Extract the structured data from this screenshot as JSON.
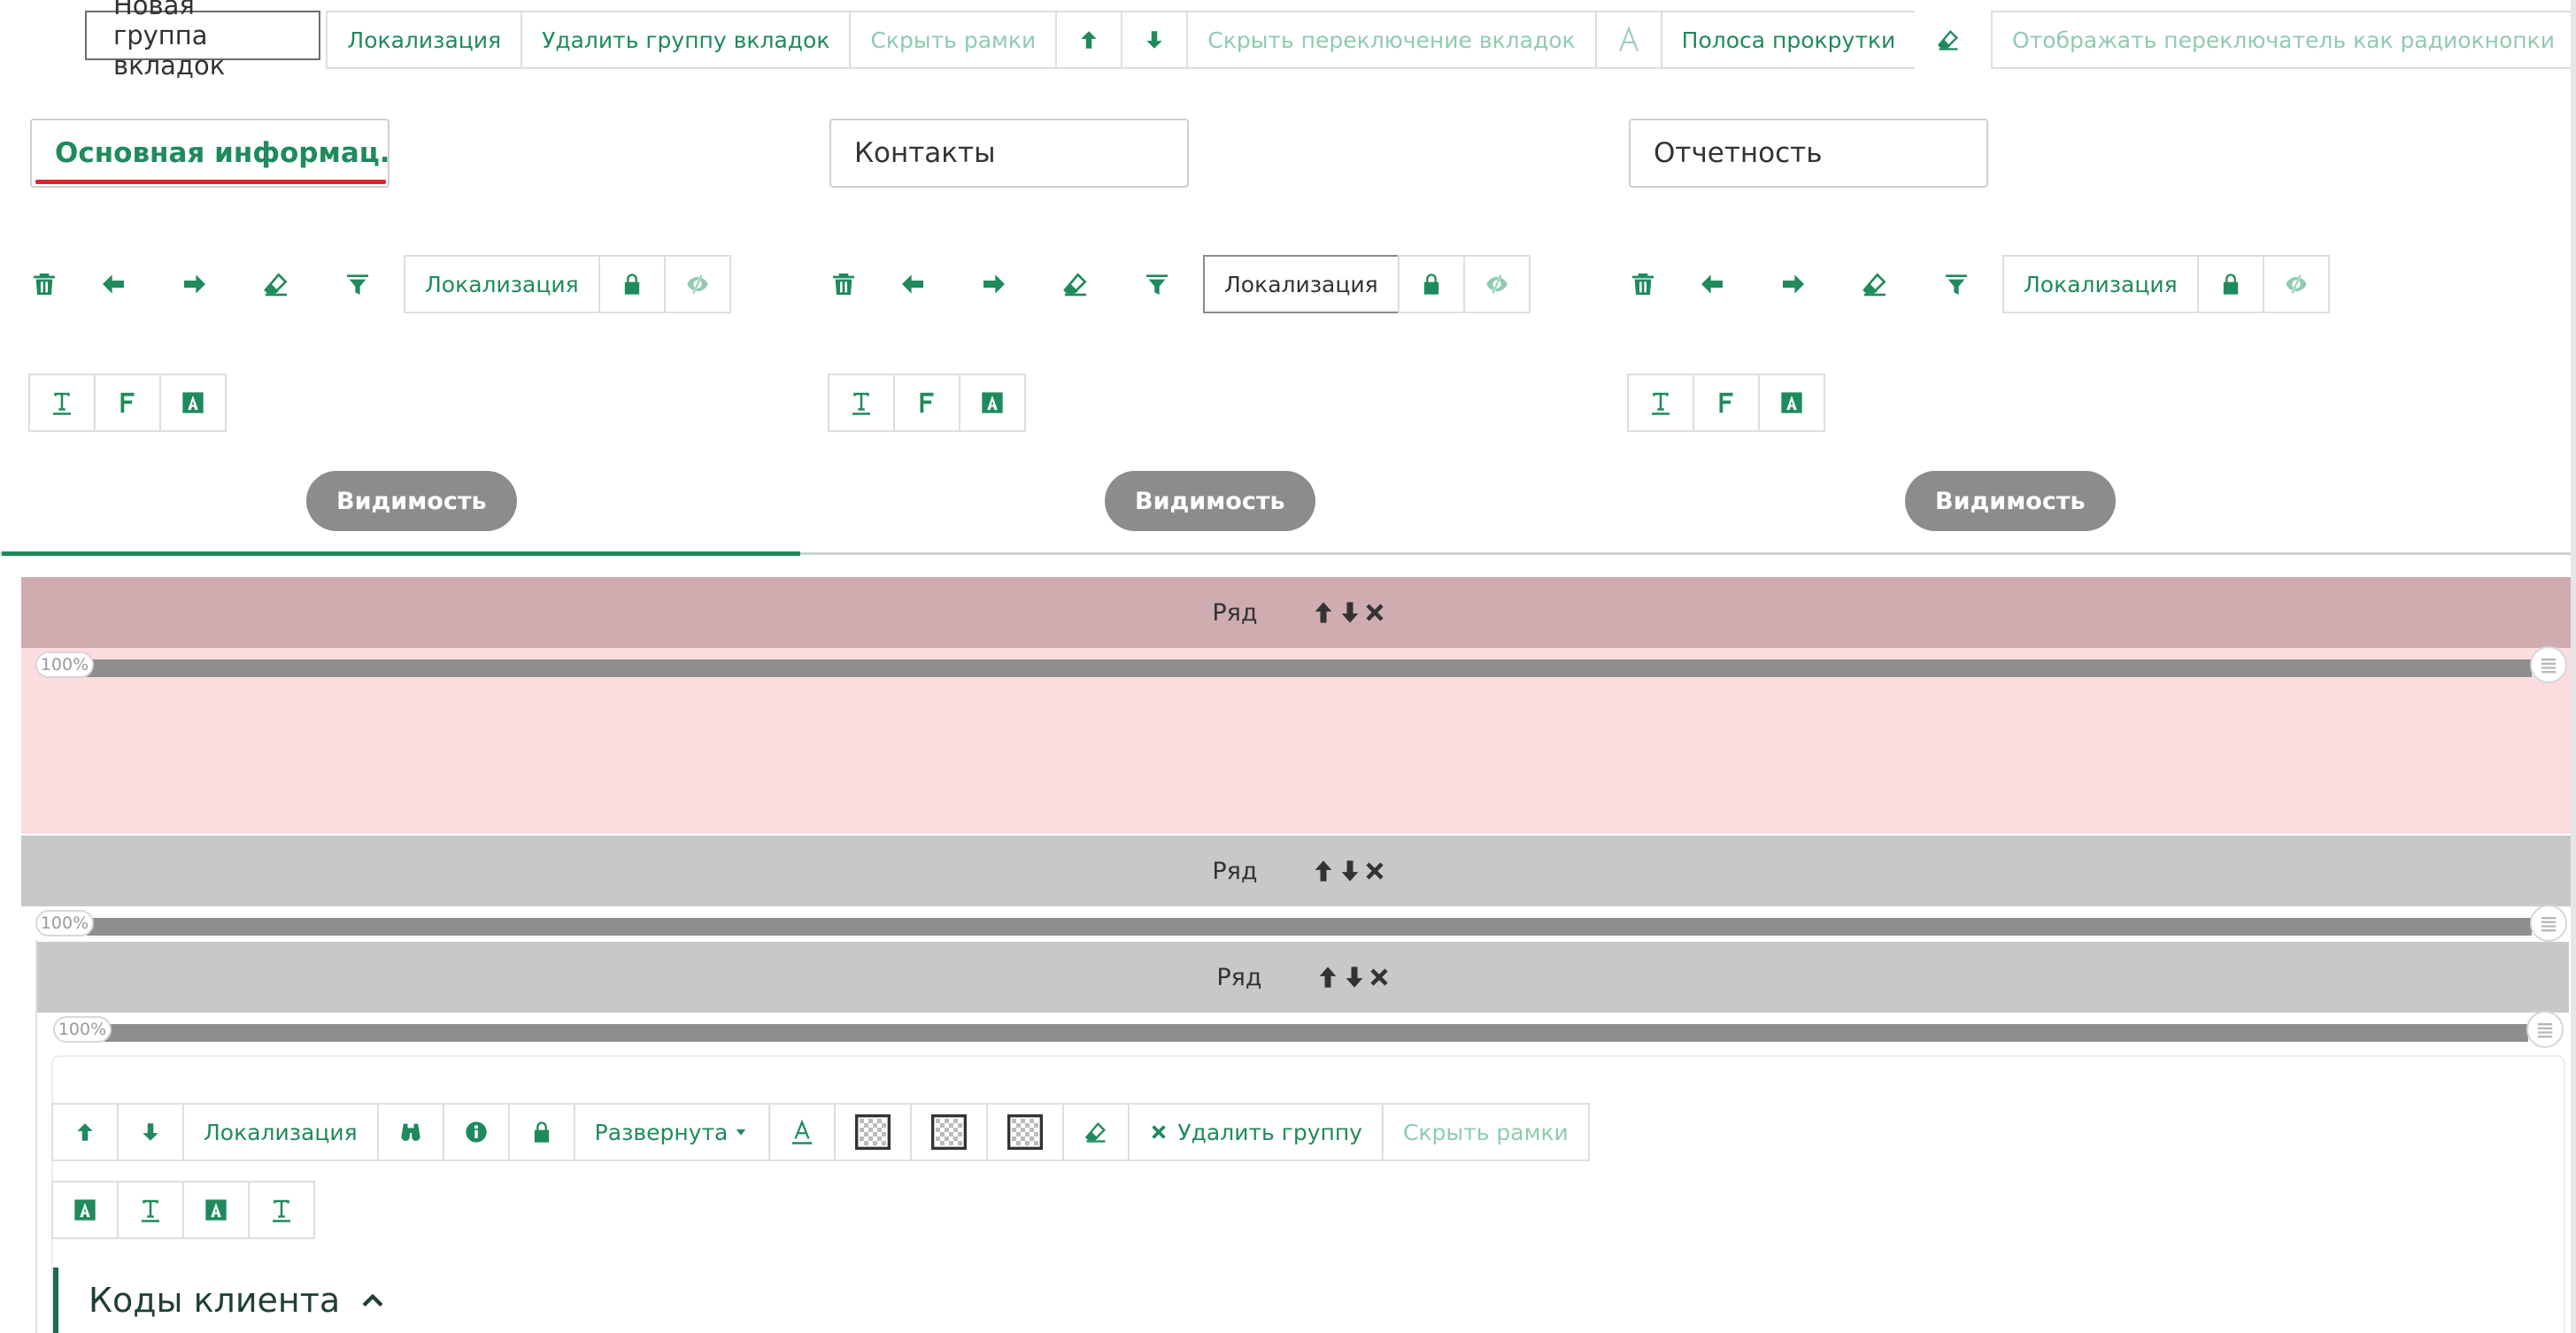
{
  "toolbar": {
    "new_group": "Новая группа вкладок",
    "localization": "Локализация",
    "delete_group": "Удалить группу вкладок",
    "hide_frames": "Скрыть рамки",
    "hide_switch": "Скрыть переключение вкладок",
    "scrollbar": "Полоса прокрутки",
    "radio_switch": "Отображать переключатель как радиокнопки"
  },
  "tabs": [
    {
      "title": "Основная информац...",
      "localization": "Локализация",
      "visibility": "Видимость"
    },
    {
      "title": "Контакты",
      "localization": "Локализация",
      "visibility": "Видимость"
    },
    {
      "title": "Отчетность",
      "localization": "Локализация",
      "visibility": "Видимость"
    }
  ],
  "rows": [
    {
      "label": "Ряд",
      "percent": "100%",
      "width_fraction": 1.0
    },
    {
      "label": "Ряд",
      "percent": "100%",
      "width_fraction": 1.0
    },
    {
      "label": "Ряд",
      "percent": "100%",
      "width_fraction": 1.0
    }
  ],
  "group_toolbar": {
    "localization": "Локализация",
    "state": "Развернута",
    "delete_group": "Удалить группу",
    "hide_frames": "Скрыть рамки"
  },
  "section": {
    "title": "Коды клиента"
  },
  "colors": {
    "accent": "#1f8a5b",
    "accent_light": "#8fcbb0",
    "active_tab_marker": "#d9232d",
    "row1_bar": "#cfacb0",
    "row1_body": "#fcdcdf",
    "row_bar": "#c8c8c8"
  }
}
